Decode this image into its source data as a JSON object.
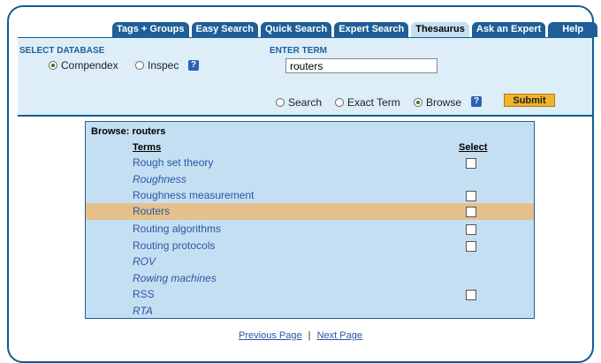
{
  "tabs": [
    {
      "label": "Tags + Groups",
      "active": false
    },
    {
      "label": "Easy Search",
      "active": false
    },
    {
      "label": "Quick Search",
      "active": false
    },
    {
      "label": "Expert Search",
      "active": false
    },
    {
      "label": "Thesaurus",
      "active": true
    },
    {
      "label": "Ask an Expert",
      "active": false
    },
    {
      "label": "Help",
      "active": false
    }
  ],
  "database": {
    "label": "SELECT DATABASE",
    "options": [
      {
        "label": "Compendex",
        "selected": true
      },
      {
        "label": "Inspec",
        "selected": false
      }
    ]
  },
  "term": {
    "label": "ENTER TERM",
    "value": "routers"
  },
  "modes": [
    {
      "label": "Search",
      "selected": false
    },
    {
      "label": "Exact Term",
      "selected": false
    },
    {
      "label": "Browse",
      "selected": true
    }
  ],
  "help_label": "?",
  "submit_label": "Submit",
  "results": {
    "title": "Browse: routers",
    "col_terms": "Terms",
    "col_select": "Select",
    "rows": [
      {
        "term": "Rough set theory",
        "italic": false,
        "checkbox": true,
        "highlighted": false
      },
      {
        "term": "Roughness",
        "italic": true,
        "checkbox": false,
        "highlighted": false
      },
      {
        "term": "Roughness measurement",
        "italic": false,
        "checkbox": true,
        "highlighted": false
      },
      {
        "term": "Routers",
        "italic": false,
        "checkbox": true,
        "highlighted": true
      },
      {
        "term": "Routing algorithms",
        "italic": false,
        "checkbox": true,
        "highlighted": false
      },
      {
        "term": "Routing protocols",
        "italic": false,
        "checkbox": true,
        "highlighted": false
      },
      {
        "term": "ROV",
        "italic": true,
        "checkbox": false,
        "highlighted": false
      },
      {
        "term": "Rowing machines",
        "italic": true,
        "checkbox": false,
        "highlighted": false
      },
      {
        "term": "RSS",
        "italic": false,
        "checkbox": true,
        "highlighted": false
      },
      {
        "term": "RTA",
        "italic": true,
        "checkbox": false,
        "highlighted": false
      }
    ]
  },
  "pager": {
    "prev": "Previous Page",
    "sep": "|",
    "next": "Next Page"
  },
  "colors": {
    "frame": "#0f5d94",
    "tab": "#1f5e98",
    "tab_active": "#c5dff2",
    "highlight": "#e6c08a",
    "submit": "#f3b32a"
  }
}
